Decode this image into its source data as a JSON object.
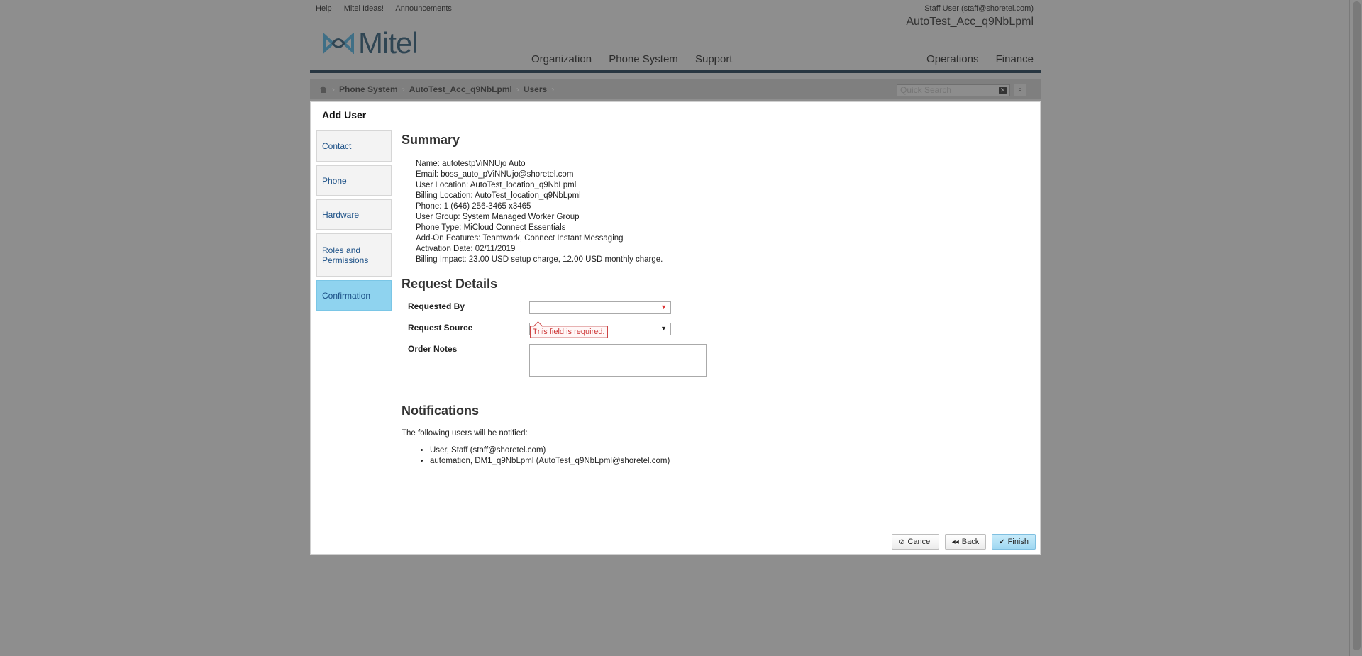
{
  "header": {
    "top_links": [
      "Help",
      "Mitel Ideas!",
      "Announcements"
    ],
    "user": "Staff User (staff@shoretel.com)",
    "account": "AutoTest_Acc_q9NbLpml",
    "logo_text": "Mitel",
    "nav_left": [
      "Organization",
      "Phone System",
      "Support"
    ],
    "nav_right": [
      "Operations",
      "Finance"
    ]
  },
  "breadcrumb": {
    "items": [
      "Phone System",
      "AutoTest_Acc_q9NbLpml",
      "Users"
    ],
    "search_placeholder": "Quick Search"
  },
  "modal": {
    "title": "Add User",
    "steps": [
      "Contact",
      "Phone",
      "Hardware",
      "Roles and Permissions",
      "Confirmation"
    ],
    "active_step": "Confirmation",
    "summary_title": "Summary",
    "summary_lines": [
      "Name: autotestpViNNUjo Auto",
      "Email: boss_auto_pViNNUjo@shoretel.com",
      "User Location: AutoTest_location_q9NbLpml",
      "Billing Location: AutoTest_location_q9NbLpml",
      "Phone: 1 (646) 256-3465 x3465",
      "User Group: System Managed Worker Group",
      "Phone Type: MiCloud Connect Essentials",
      "Add-On Features: Teamwork, Connect Instant Messaging",
      "Activation Date: 02/11/2019",
      "Billing Impact: 23.00 USD setup charge, 12.00 USD monthly charge."
    ],
    "request_title": "Request Details",
    "requested_by_label": "Requested By",
    "request_source_label": "Request Source",
    "order_notes_label": "Order Notes",
    "error_text": "This field is required.",
    "notifications_title": "Notifications",
    "notifications_text": "The following users will be notified:",
    "notify_users": [
      "User, Staff (staff@shoretel.com)",
      "automation, DM1_q9NbLpml (AutoTest_q9NbLpml@shoretel.com)"
    ],
    "buttons": {
      "cancel": "Cancel",
      "back": "Back",
      "finish": "Finish"
    }
  },
  "colors": {
    "active_step": "#8fd3ef",
    "header_bar": "#283641",
    "error": "#cc3333"
  }
}
